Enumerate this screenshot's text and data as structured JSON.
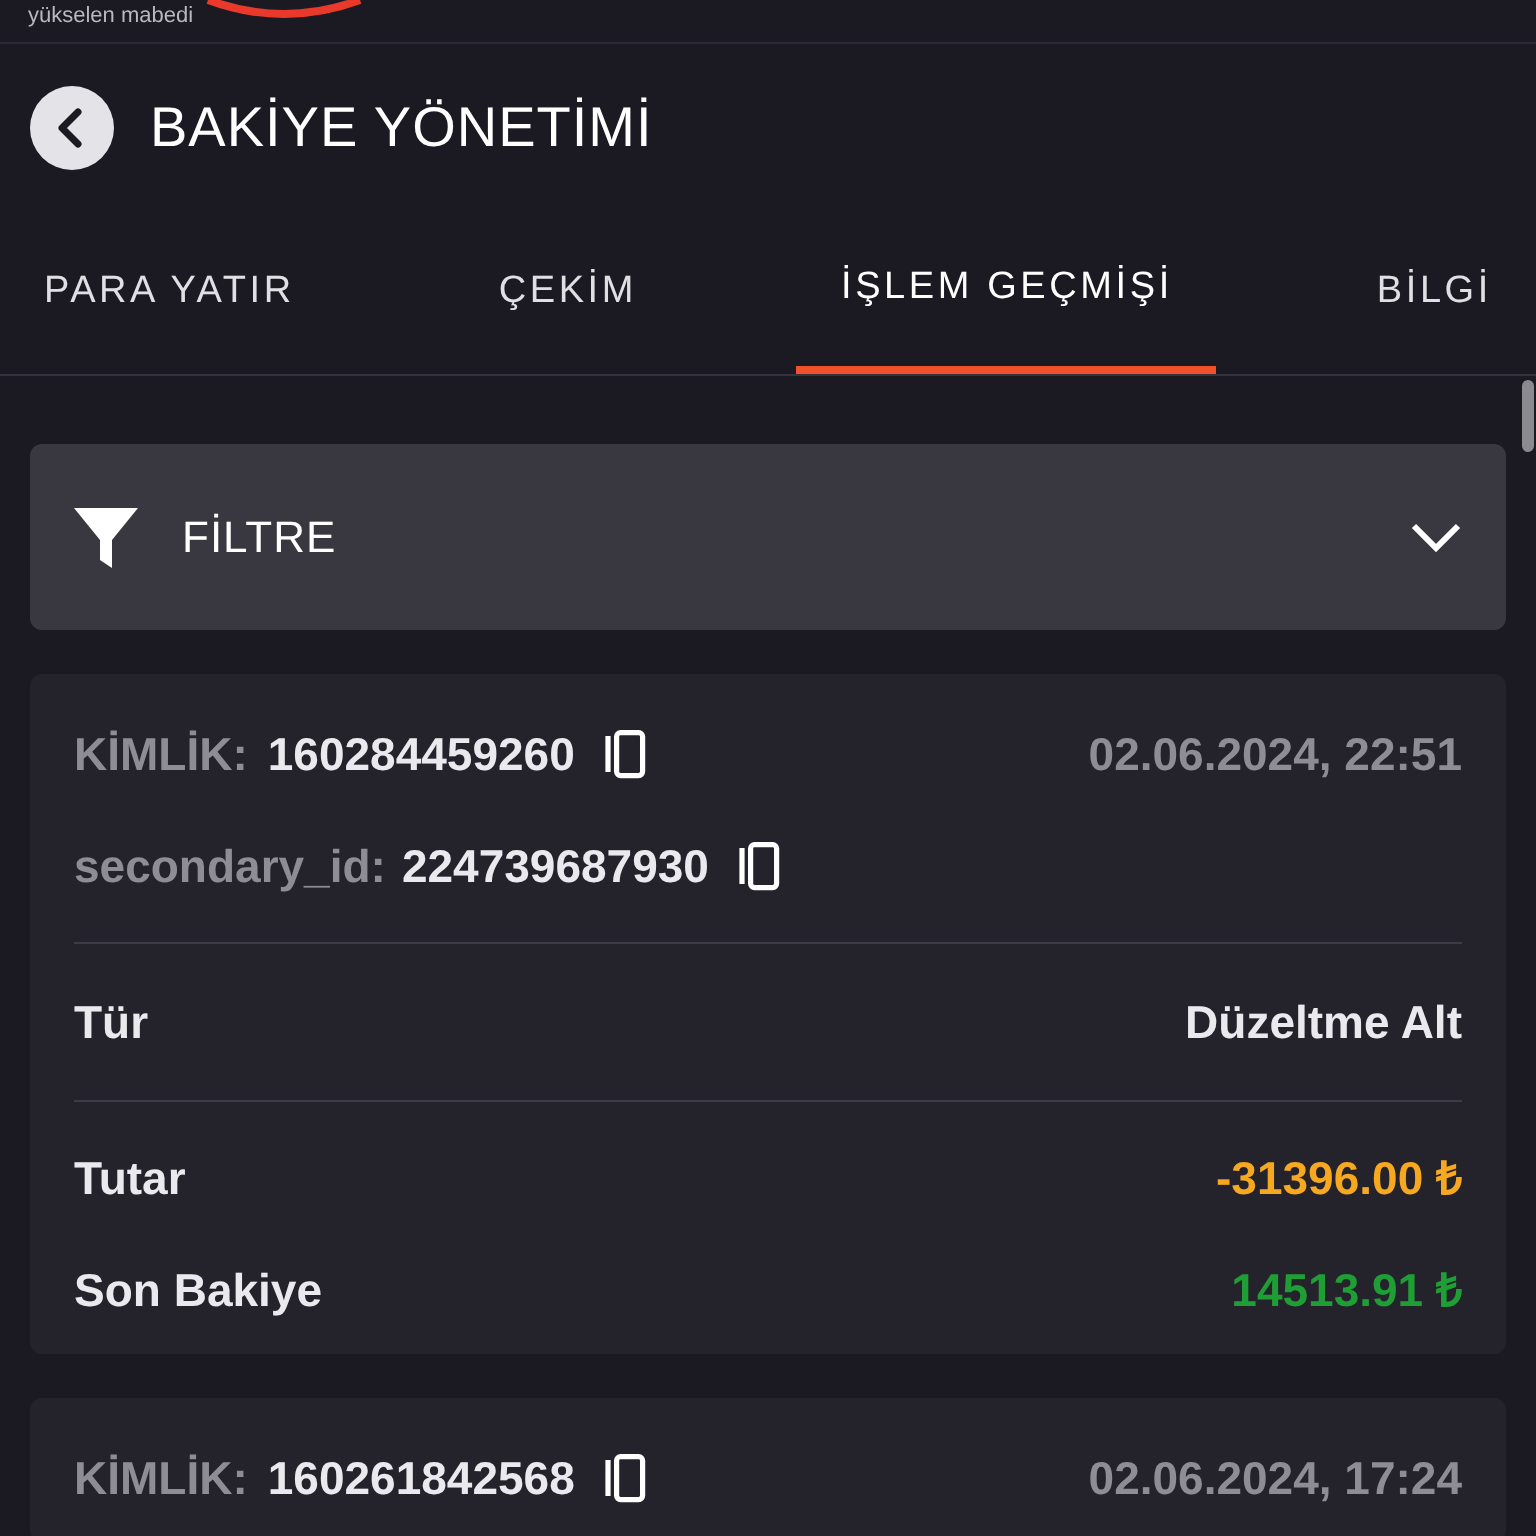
{
  "brand": {
    "tagline": "yükselen mabedi"
  },
  "header": {
    "title": "BAKİYE YÖNETİMİ"
  },
  "tabs": [
    {
      "label": "PARA YATIR",
      "selected": false
    },
    {
      "label": "ÇEKİM",
      "selected": false
    },
    {
      "label": "İŞLEM GEÇMİŞİ",
      "selected": true
    },
    {
      "label": "BİLGİ",
      "selected": false
    }
  ],
  "filter": {
    "label": "FİLTRE",
    "expanded": false
  },
  "transactions": [
    {
      "id_label": "KİMLİK:",
      "id": "160284459260",
      "secondary_label": "secondary_id:",
      "secondary_id": "224739687930",
      "date": "02.06.2024, 22:51",
      "type_label": "Tür",
      "type": "Düzeltme Alt",
      "amounts": [
        {
          "label": "Tutar",
          "value": "-31396.00 ₺",
          "color": "#f6a821"
        },
        {
          "label": "Son Bakiye",
          "value": "14513.91 ₺",
          "color": "#1e9e35"
        }
      ]
    },
    {
      "id_label": "KİMLİK:",
      "id": "160261842568",
      "date": "02.06.2024, 17:24"
    }
  ]
}
